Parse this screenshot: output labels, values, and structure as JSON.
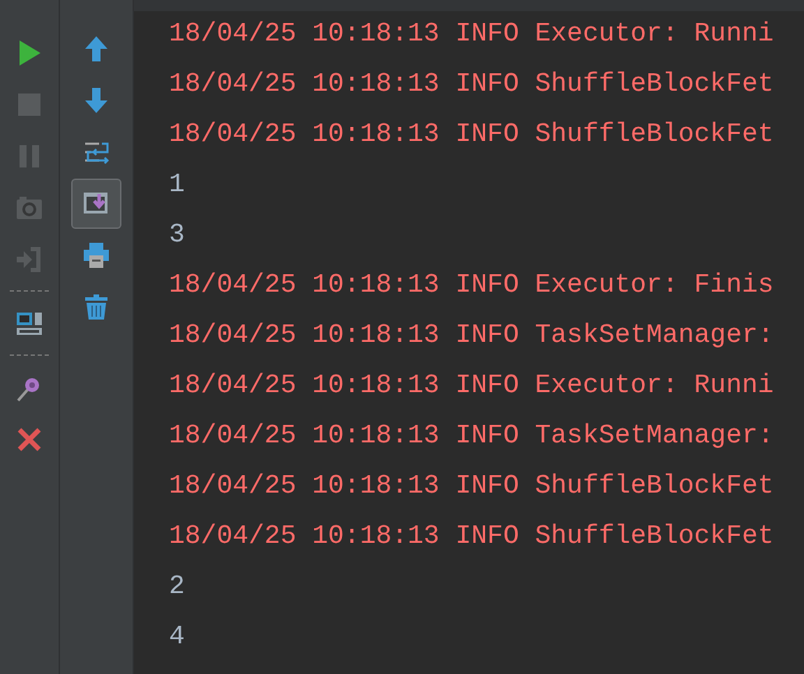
{
  "left_toolbar": [
    {
      "kind": "run",
      "disabled": false
    },
    {
      "kind": "stop",
      "disabled": true
    },
    {
      "kind": "pause",
      "disabled": true
    },
    {
      "kind": "camera",
      "disabled": true
    },
    {
      "kind": "exit",
      "disabled": true
    },
    {
      "kind": "separator"
    },
    {
      "kind": "layout",
      "disabled": false
    },
    {
      "kind": "separator"
    },
    {
      "kind": "pin",
      "disabled": false
    },
    {
      "kind": "close",
      "disabled": false
    }
  ],
  "right_toolbar": [
    {
      "kind": "up",
      "on": false
    },
    {
      "kind": "down",
      "on": false
    },
    {
      "kind": "wrap",
      "on": false
    },
    {
      "kind": "scroll-end",
      "on": true
    },
    {
      "kind": "print",
      "on": false
    },
    {
      "kind": "trash",
      "on": false
    }
  ],
  "console": {
    "lines": [
      {
        "kind": "log",
        "text": "18/04/25 10:18:13 INFO Executor: Runni"
      },
      {
        "kind": "log",
        "text": "18/04/25 10:18:13 INFO ShuffleBlockFet"
      },
      {
        "kind": "log",
        "text": "18/04/25 10:18:13 INFO ShuffleBlockFet"
      },
      {
        "kind": "output",
        "text": "1"
      },
      {
        "kind": "output",
        "text": "3"
      },
      {
        "kind": "log",
        "text": "18/04/25 10:18:13 INFO Executor: Finis"
      },
      {
        "kind": "log",
        "text": "18/04/25 10:18:13 INFO TaskSetManager:"
      },
      {
        "kind": "log",
        "text": "18/04/25 10:18:13 INFO Executor: Runni"
      },
      {
        "kind": "log",
        "text": "18/04/25 10:18:13 INFO TaskSetManager:"
      },
      {
        "kind": "log",
        "text": "18/04/25 10:18:13 INFO ShuffleBlockFet"
      },
      {
        "kind": "log",
        "text": "18/04/25 10:18:13 INFO ShuffleBlockFet"
      },
      {
        "kind": "output",
        "text": "2"
      },
      {
        "kind": "output",
        "text": "4"
      }
    ]
  }
}
